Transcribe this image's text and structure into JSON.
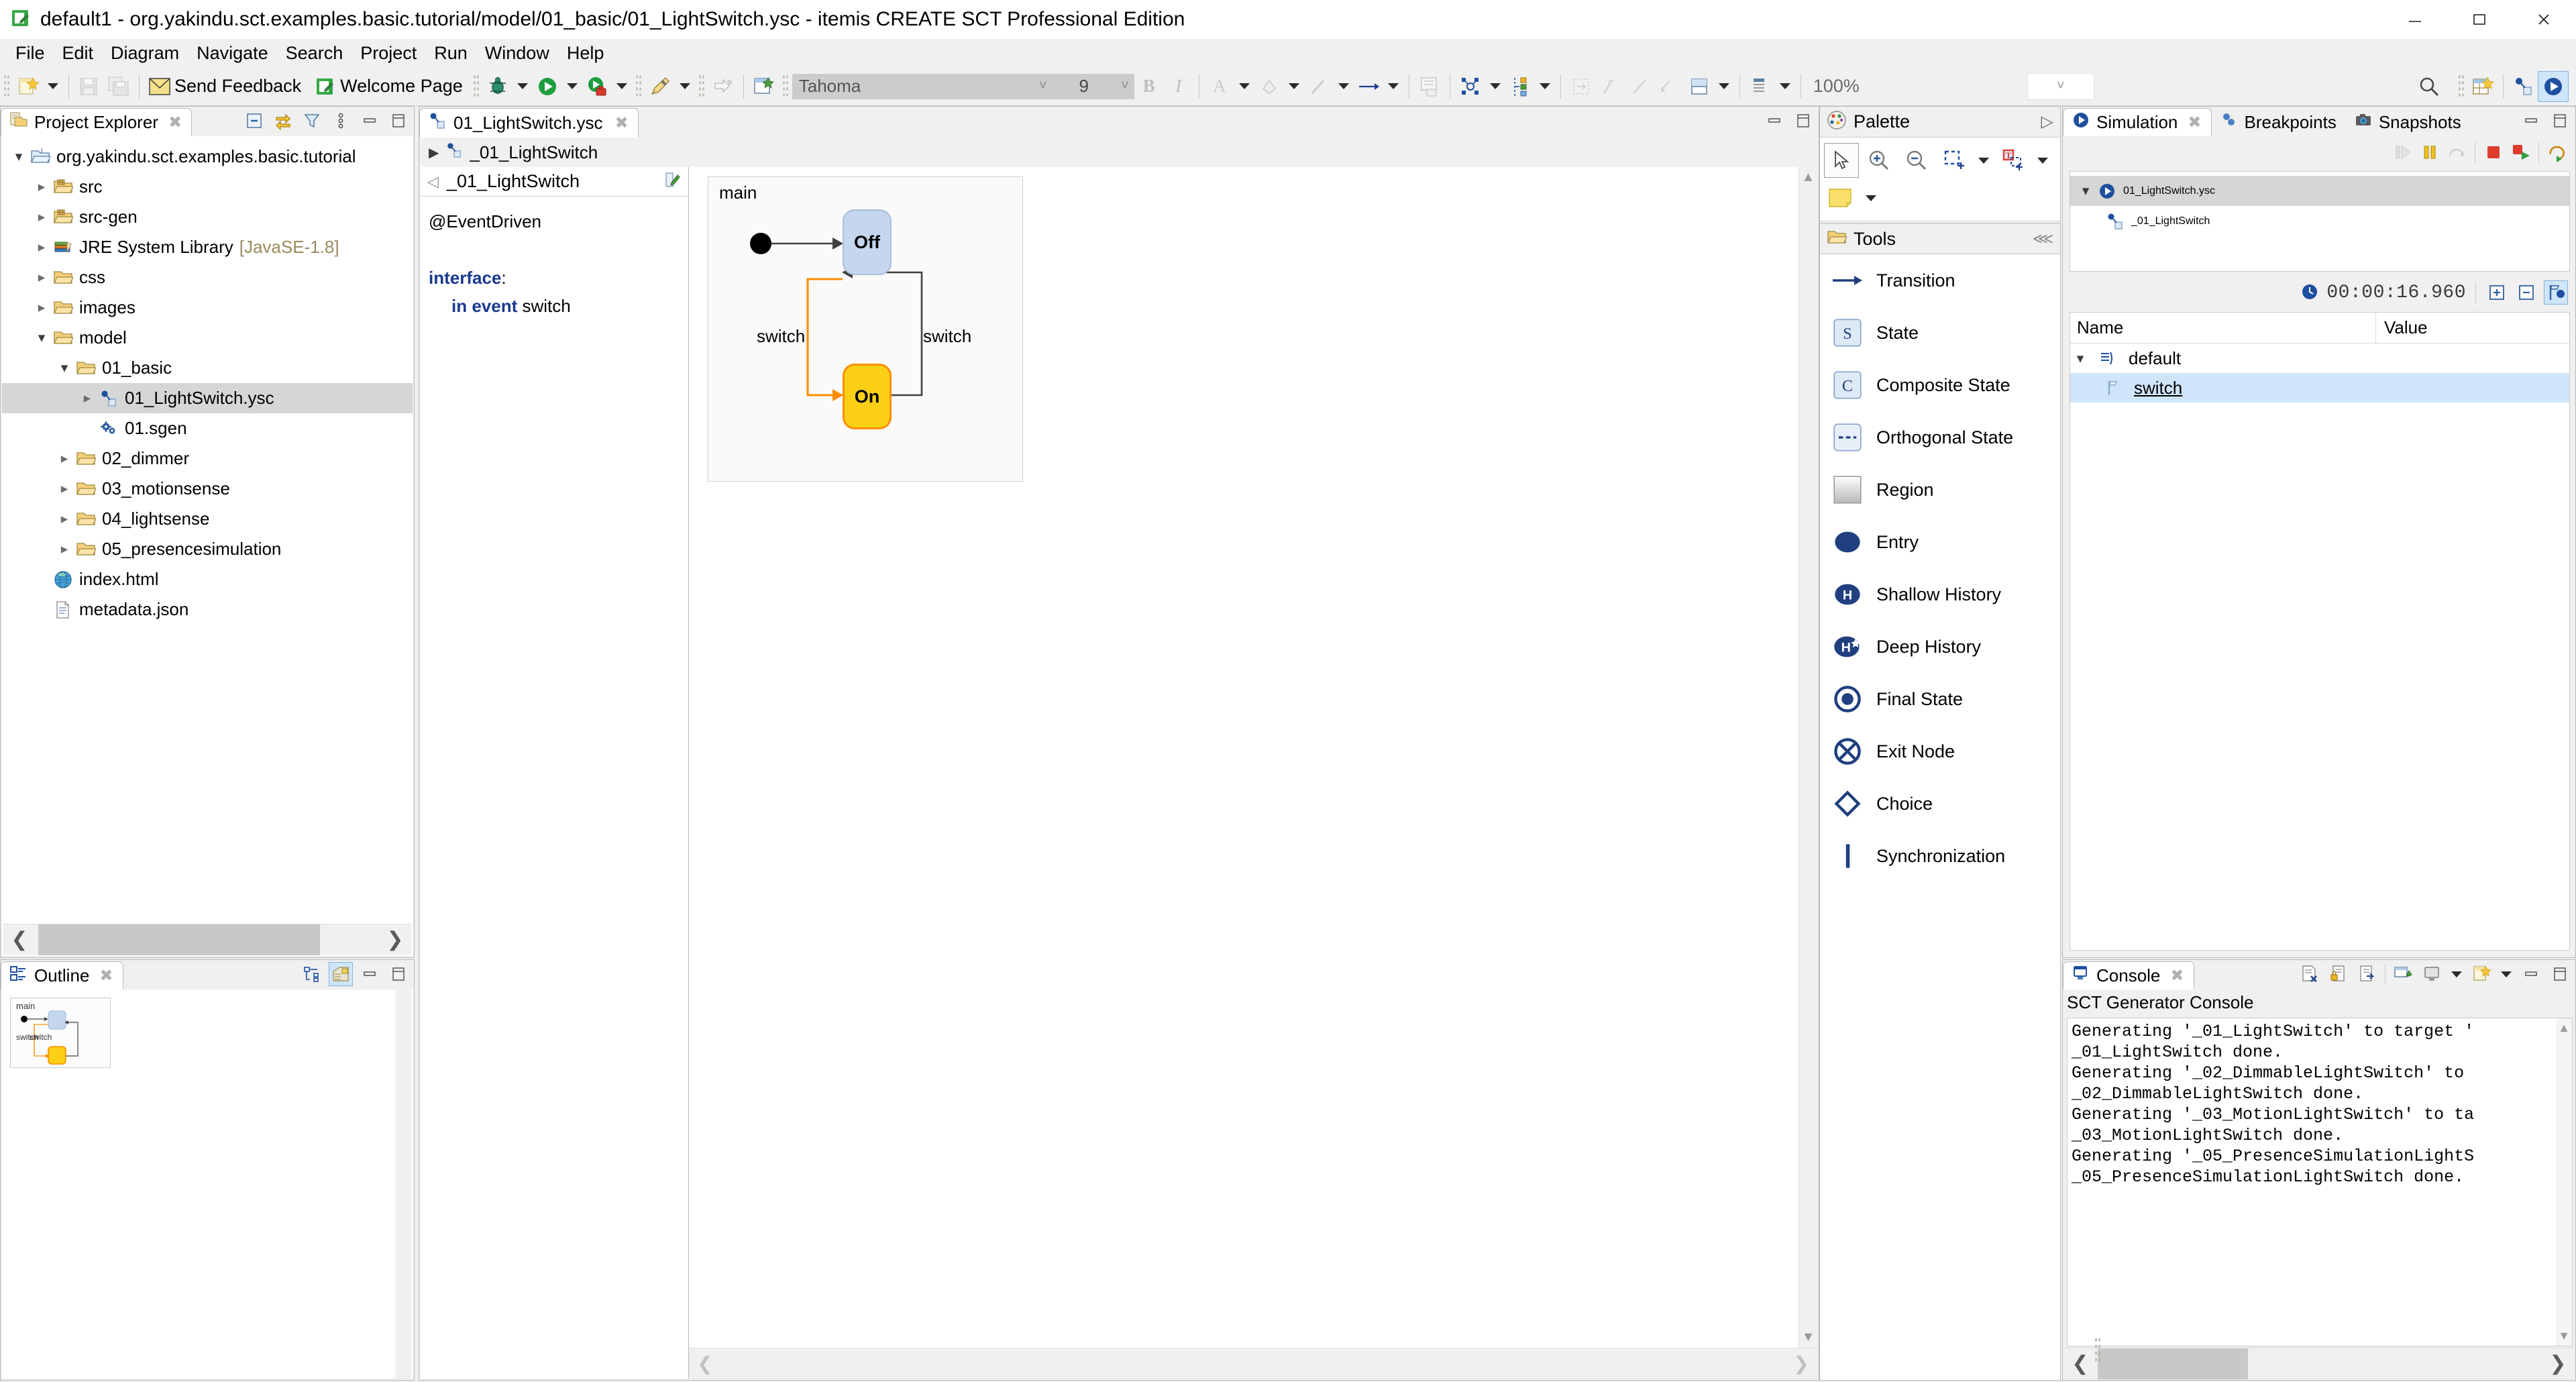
{
  "window": {
    "title": "default1 - org.yakindu.sct.examples.basic.tutorial/model/01_basic/01_LightSwitch.ysc - itemis CREATE SCT Professional Edition",
    "app_icon": "editor-green-icon",
    "minimize_label": "—",
    "maximize_label": "□",
    "close_label": "✕"
  },
  "menu": {
    "items": [
      "File",
      "Edit",
      "Diagram",
      "Navigate",
      "Search",
      "Project",
      "Run",
      "Window",
      "Help"
    ]
  },
  "toolbar": {
    "send_feedback_label": "Send Feedback",
    "welcome_page_label": "Welcome Page",
    "font_name": "Tahoma",
    "font_size": "9",
    "zoom_level": "100%",
    "bold_label": "B",
    "italic_label": "I",
    "font_color_label": "A"
  },
  "project_explorer": {
    "tab_label": "Project Explorer",
    "tree": [
      {
        "label": "org.yakindu.sct.examples.basic.tutorial",
        "icon": "java-project-icon",
        "indent": 0,
        "arrow": "open",
        "selected": false
      },
      {
        "label": "src",
        "icon": "source-folder-icon",
        "indent": 1,
        "arrow": "closed",
        "selected": false
      },
      {
        "label": "src-gen",
        "icon": "source-folder-icon",
        "indent": 1,
        "arrow": "closed",
        "selected": false
      },
      {
        "label": "JRE System Library",
        "sub": "[JavaSE-1.8]",
        "icon": "library-icon",
        "indent": 1,
        "arrow": "closed",
        "selected": false
      },
      {
        "label": "css",
        "icon": "folder-icon",
        "indent": 1,
        "arrow": "closed",
        "selected": false
      },
      {
        "label": "images",
        "icon": "folder-icon",
        "indent": 1,
        "arrow": "closed",
        "selected": false
      },
      {
        "label": "model",
        "icon": "folder-icon",
        "indent": 1,
        "arrow": "open",
        "selected": false
      },
      {
        "label": "01_basic",
        "icon": "folder-icon",
        "indent": 2,
        "arrow": "open",
        "selected": false
      },
      {
        "label": "01_LightSwitch.ysc",
        "icon": "statechart-icon",
        "indent": 3,
        "arrow": "closed",
        "selected": true
      },
      {
        "label": "01.sgen",
        "icon": "sgen-icon",
        "indent": 3,
        "arrow": "none",
        "selected": false
      },
      {
        "label": "02_dimmer",
        "icon": "folder-icon",
        "indent": 2,
        "arrow": "closed",
        "selected": false
      },
      {
        "label": "03_motionsense",
        "icon": "folder-icon",
        "indent": 2,
        "arrow": "closed",
        "selected": false
      },
      {
        "label": "04_lightsense",
        "icon": "folder-icon",
        "indent": 2,
        "arrow": "closed",
        "selected": false
      },
      {
        "label": "05_presencesimulation",
        "icon": "folder-icon",
        "indent": 2,
        "arrow": "closed",
        "selected": false
      },
      {
        "label": "index.html",
        "icon": "html-icon",
        "indent": 1,
        "arrow": "none",
        "selected": false
      },
      {
        "label": "metadata.json",
        "icon": "file-icon",
        "indent": 1,
        "arrow": "none",
        "selected": false
      }
    ]
  },
  "outline": {
    "tab_label": "Outline"
  },
  "editor": {
    "tab_label": "01_LightSwitch.ysc",
    "breadcrumb_label": "_01_LightSwitch",
    "definition_title": "_01_LightSwitch",
    "code": {
      "annotation": "@EventDriven",
      "interface_kw": "interface",
      "interface_colon": ":",
      "event_kw": "in event",
      "event_name": "switch"
    }
  },
  "diagram": {
    "region_label": "main",
    "state_off": "Off",
    "state_on": "On",
    "transition_left_label": "switch",
    "transition_right_label": "switch",
    "color_off_fill": "#c5d6ef",
    "color_on_fill": "#fdd017",
    "color_active_border": "#ff8c00"
  },
  "palette": {
    "title": "Palette",
    "tools_title": "Tools",
    "tools": [
      {
        "label": "Transition",
        "icon": "transition-arrow-icon"
      },
      {
        "label": "State",
        "icon": "state-s-icon"
      },
      {
        "label": "Composite State",
        "icon": "composite-state-c-icon"
      },
      {
        "label": "Orthogonal State",
        "icon": "orthogonal-state-icon"
      },
      {
        "label": "Region",
        "icon": "region-icon"
      },
      {
        "label": "Entry",
        "icon": "entry-node-icon"
      },
      {
        "label": "Shallow History",
        "icon": "shallow-history-icon"
      },
      {
        "label": "Deep History",
        "icon": "deep-history-icon"
      },
      {
        "label": "Final State",
        "icon": "final-state-icon"
      },
      {
        "label": "Exit Node",
        "icon": "exit-node-icon"
      },
      {
        "label": "Choice",
        "icon": "choice-diamond-icon"
      },
      {
        "label": "Synchronization",
        "icon": "synchronization-bar-icon"
      }
    ]
  },
  "simulation": {
    "tabs": [
      {
        "label": "Simulation",
        "icon": "simulation-play-icon",
        "active": true
      },
      {
        "label": "Breakpoints",
        "icon": "breakpoints-icon",
        "active": false
      },
      {
        "label": "Snapshots",
        "icon": "snapshots-camera-icon",
        "active": false
      }
    ],
    "tree": [
      {
        "label": "01_LightSwitch.ysc",
        "icon": "simulation-play-icon",
        "indent": 0,
        "arrow": "open",
        "selected": true
      },
      {
        "label": "_01_LightSwitch",
        "icon": "statechart-icon",
        "indent": 1,
        "arrow": "none",
        "selected": false
      }
    ],
    "clock": "00:00:16.960",
    "table": {
      "headers": [
        "Name",
        "Value"
      ],
      "rows": [
        {
          "name": "default",
          "value": "",
          "icon": "interface-icon",
          "indent": 0,
          "arrow": "open",
          "selected": false
        },
        {
          "name": "switch",
          "value": "",
          "icon": "event-flag-icon",
          "indent": 1,
          "arrow": "none",
          "selected": true
        }
      ]
    }
  },
  "console": {
    "tab_label": "Console",
    "subtitle": "SCT Generator Console",
    "lines": [
      "Generating '_01_LightSwitch' to target '",
      "_01_LightSwitch done.",
      "Generating '_02_DimmableLightSwitch' to ",
      "_02_DimmableLightSwitch done.",
      "Generating '_03_MotionLightSwitch' to ta",
      "_03_MotionLightSwitch done.",
      "Generating '_05_PresenceSimulationLightS",
      "_05_PresenceSimulationLightSwitch done."
    ]
  }
}
